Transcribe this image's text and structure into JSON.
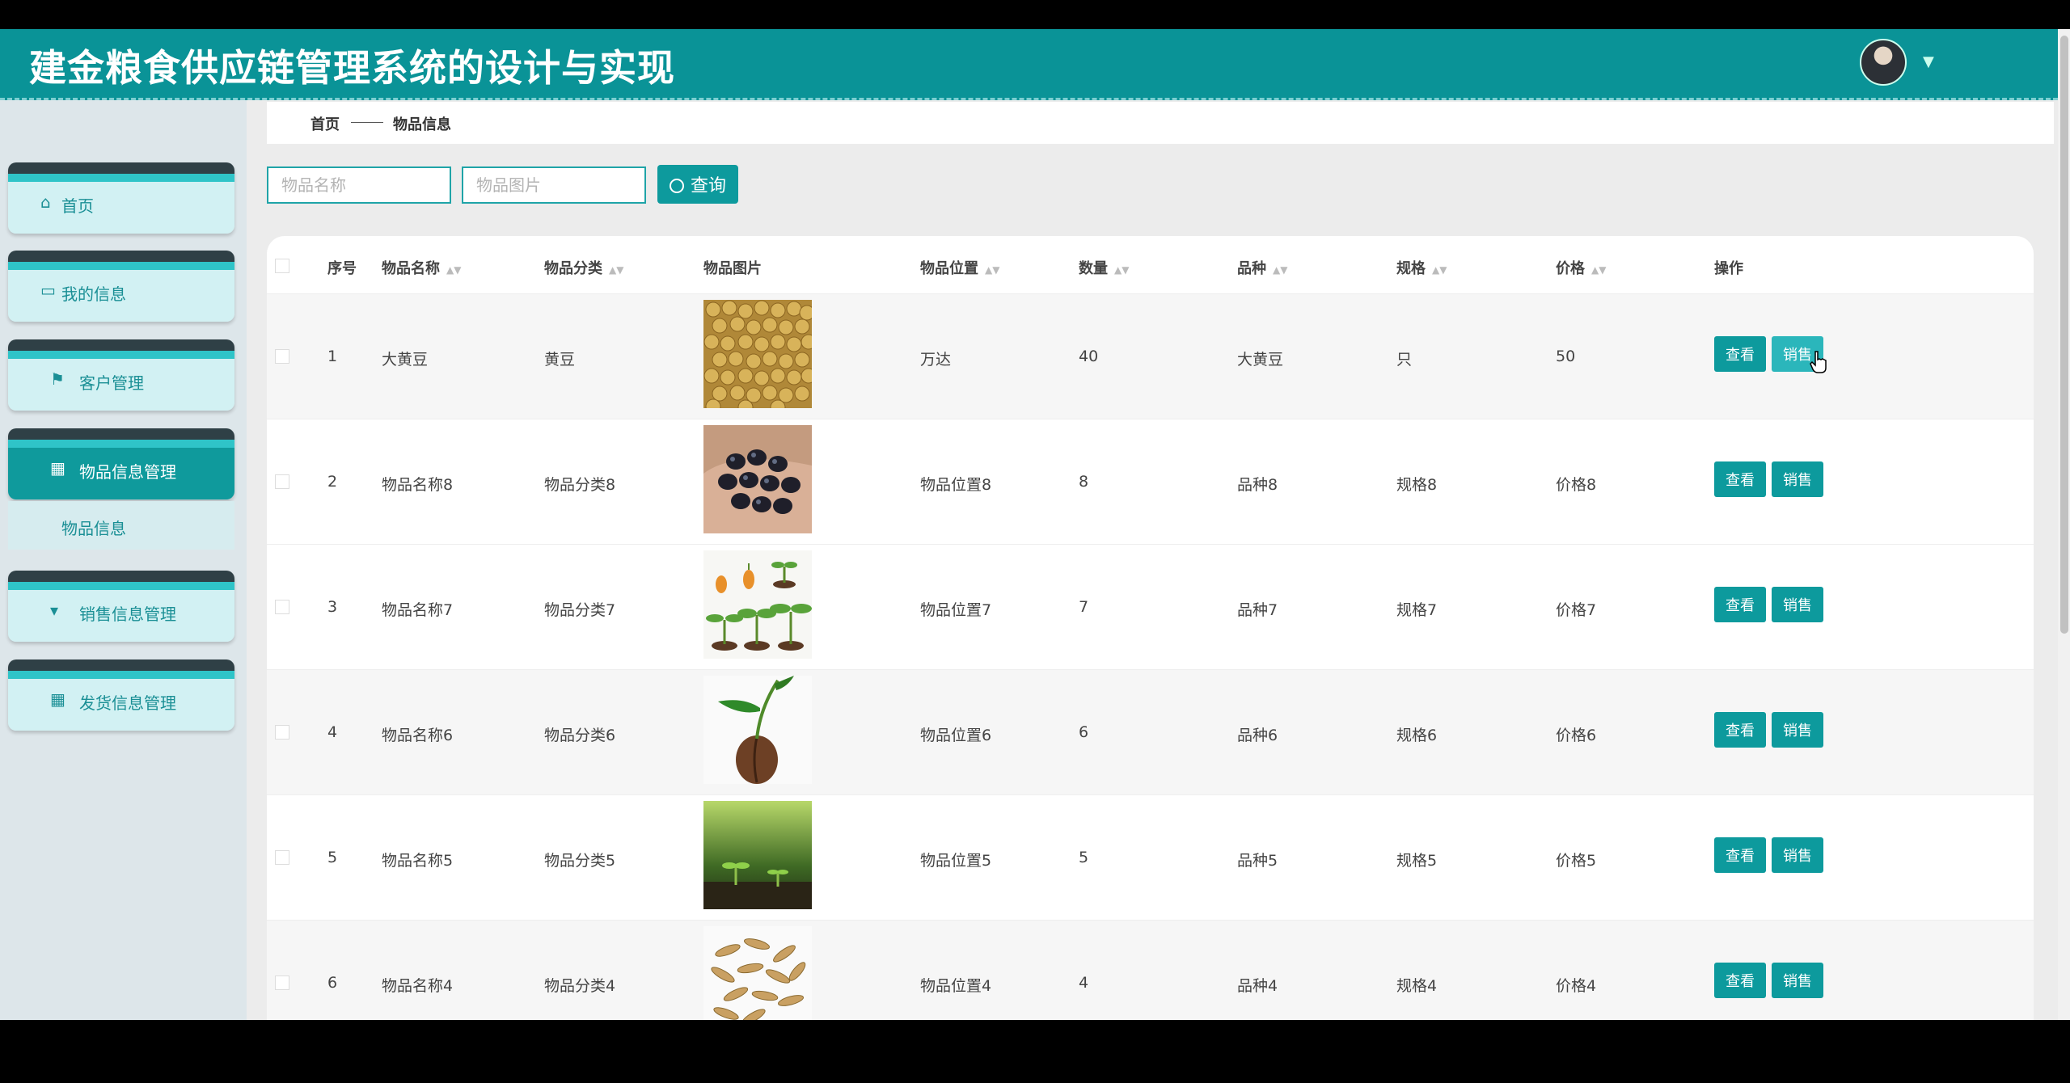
{
  "app": {
    "title": "建金粮食供应链管理系统的设计与实现"
  },
  "sidebar": {
    "items": [
      {
        "label": "首页",
        "icon": "home-icon"
      },
      {
        "label": "我的信息",
        "icon": "card-icon"
      },
      {
        "label": "客户管理",
        "icon": "flag-icon"
      },
      {
        "label": "物品信息管理",
        "icon": "grid-icon",
        "active": true
      },
      {
        "label": "销售信息管理",
        "icon": "bookmark-icon"
      },
      {
        "label": "发货信息管理",
        "icon": "grid-icon"
      }
    ],
    "sub_item": "物品信息"
  },
  "breadcrumb": {
    "home": "首页",
    "current": "物品信息"
  },
  "search": {
    "name_placeholder": "物品名称",
    "image_placeholder": "物品图片",
    "button_label": "查询"
  },
  "table": {
    "headers": [
      "序号",
      "物品名称",
      "物品分类",
      "物品图片",
      "物品位置",
      "数量",
      "品种",
      "规格",
      "价格",
      "操作"
    ],
    "view_label": "查看",
    "sell_label": "销售",
    "rows": [
      {
        "no": "1",
        "name": "大黄豆",
        "category": "黄豆",
        "image": "soybeans",
        "location": "万达",
        "qty": "40",
        "variety": "大黄豆",
        "spec": "只",
        "price": "50"
      },
      {
        "no": "2",
        "name": "物品名称8",
        "category": "物品分类8",
        "image": "black-beans",
        "location": "物品位置8",
        "qty": "8",
        "variety": "品种8",
        "spec": "规格8",
        "price": "价格8"
      },
      {
        "no": "3",
        "name": "物品名称7",
        "category": "物品分类7",
        "image": "sprouts",
        "location": "物品位置7",
        "qty": "7",
        "variety": "品种7",
        "spec": "规格7",
        "price": "价格7"
      },
      {
        "no": "4",
        "name": "物品名称6",
        "category": "物品分类6",
        "image": "seed-sprout",
        "location": "物品位置6",
        "qty": "6",
        "variety": "品种6",
        "spec": "规格6",
        "price": "价格6"
      },
      {
        "no": "5",
        "name": "物品名称5",
        "category": "物品分类5",
        "image": "seedlings",
        "location": "物品位置5",
        "qty": "5",
        "variety": "品种5",
        "spec": "规格5",
        "price": "价格5"
      },
      {
        "no": "6",
        "name": "物品名称4",
        "category": "物品分类4",
        "image": "rice-grains",
        "location": "物品位置4",
        "qty": "4",
        "variety": "品种4",
        "spec": "规格4",
        "price": "价格4"
      }
    ]
  },
  "colors": {
    "brand": "#0a9397",
    "button": "#0d9a9d",
    "sidebar_bg": "#dde6ea"
  }
}
